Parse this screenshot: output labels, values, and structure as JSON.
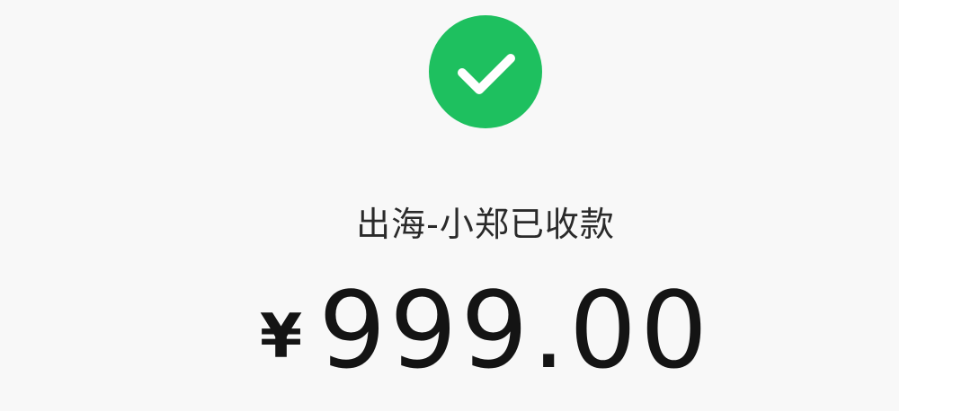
{
  "payment": {
    "status_icon": "check-icon",
    "status_color": "#1ec05f",
    "status_text": "出海-小郑已收款",
    "currency_symbol": "¥",
    "amount": "999.00"
  }
}
